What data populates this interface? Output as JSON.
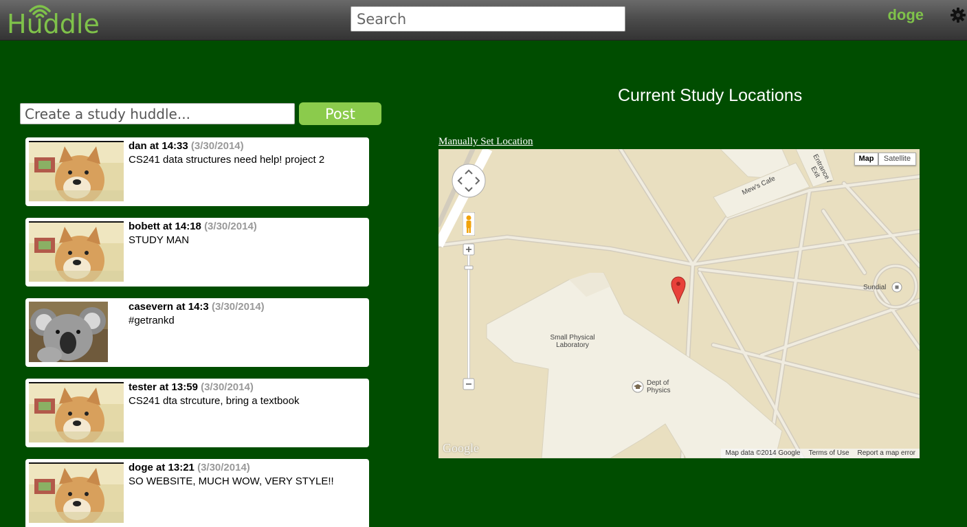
{
  "header": {
    "logo_text": "Huddle",
    "search_placeholder": "Search",
    "username": "doge"
  },
  "composer": {
    "placeholder": "Create a study huddle...",
    "post_label": "Post"
  },
  "posts": [
    {
      "author": "dan",
      "time": "14:33",
      "date": "(3/30/2014)",
      "body": "CS241 data structures need help! project 2",
      "avatar": "doge"
    },
    {
      "author": "bobett",
      "time": "14:18",
      "date": "(3/30/2014)",
      "body": "STUDY MAN",
      "avatar": "doge"
    },
    {
      "author": "casevern",
      "time": "14:3",
      "date": "(3/30/2014)",
      "body": "#getrankd",
      "avatar": "koala"
    },
    {
      "author": "tester",
      "time": "13:59",
      "date": "(3/30/2014)",
      "body": "CS241 dta strcuture, bring a textbook",
      "avatar": "doge"
    },
    {
      "author": "doge",
      "time": "13:21",
      "date": "(3/30/2014)",
      "body": "SO WEBSITE, MUCH WOW, VERY STYLE!!",
      "avatar": "doge"
    }
  ],
  "locations": {
    "title": "Current Study Locations",
    "manual_link": "Manually Set Location"
  },
  "map": {
    "type_map": "Map",
    "type_satellite": "Satellite",
    "labels": {
      "cafe": "Mew's Cafe",
      "entrance": "Entrance / Exit",
      "sundial": "Sundial",
      "lab": "Small Physical Laboratory",
      "physics": "Dept of Physics"
    },
    "footer": {
      "data": "Map data ©2014 Google",
      "terms": "Terms of Use",
      "report": "Report a map error"
    },
    "logo": "Google",
    "colors": {
      "land": "#e9dfc0",
      "building": "#f2efe3",
      "road": "#d6d0c2",
      "marker": "#e8413a"
    }
  },
  "colors": {
    "background": "#004d00",
    "accent": "#7fc24a",
    "post_button": "#8bcb4c"
  }
}
